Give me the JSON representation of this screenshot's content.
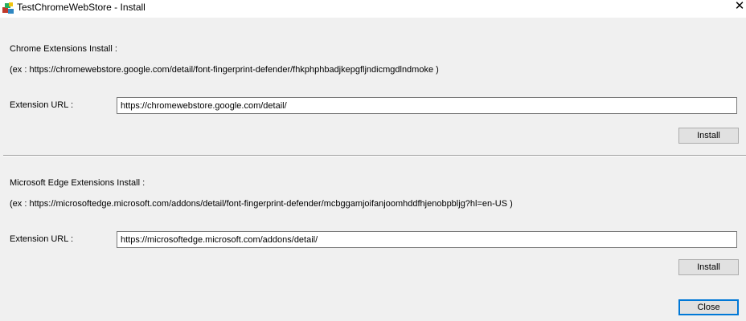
{
  "window": {
    "title": "TestChromeWebStore - Install",
    "close_glyph": "✕"
  },
  "chrome": {
    "heading": "Chrome Extensions Install :",
    "example": "(ex : https://chromewebstore.google.com/detail/font-fingerprint-defender/fhkphphbadjkepgfljndicmgdlndmoke )",
    "url_label": "Extension URL :",
    "url_value": "https://chromewebstore.google.com/detail/",
    "install_label": "Install"
  },
  "edge": {
    "heading": "Microsoft Edge Extensions Install :",
    "example": "(ex : https://microsoftedge.microsoft.com/addons/detail/font-fingerprint-defender/mcbggamjoifanjoomhddfhjenobpbljg?hl=en-US )",
    "url_label": "Extension URL :",
    "url_value": "https://microsoftedge.microsoft.com/addons/detail/",
    "install_label": "Install"
  },
  "footer": {
    "close_label": "Close"
  },
  "icons": {
    "app_icon": "app-icon",
    "close_icon": "close-icon"
  }
}
